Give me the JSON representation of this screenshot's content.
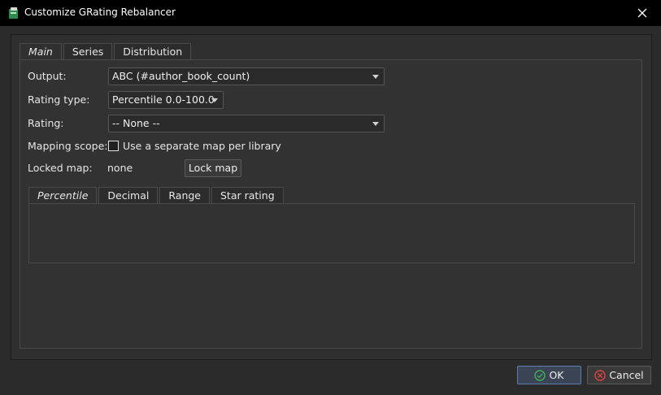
{
  "window": {
    "title": "Customize GRating Rebalancer",
    "icon": "book-icon",
    "close_icon": "close-icon"
  },
  "main_tabs": [
    {
      "label": "Main",
      "active": true
    },
    {
      "label": "Series",
      "active": false
    },
    {
      "label": "Distribution",
      "active": false
    }
  ],
  "main": {
    "output": {
      "label": "Output:",
      "value": "ABC (#author_book_count)"
    },
    "rating_type": {
      "label": "Rating type:",
      "value": "Percentile 0.0-100.0"
    },
    "rating": {
      "label": "Rating:",
      "value": "-- None --"
    },
    "mapping_scope": {
      "label": "Mapping scope:",
      "checkbox_label": "Use a separate map per library",
      "checked": false
    },
    "locked_map": {
      "label": "Locked map:",
      "value": "none",
      "button_label": "Lock map"
    }
  },
  "rating_tabs": [
    {
      "label": "Percentile",
      "active": true
    },
    {
      "label": "Decimal",
      "active": false
    },
    {
      "label": "Range",
      "active": false
    },
    {
      "label": "Star rating",
      "active": false
    }
  ],
  "buttons": {
    "ok_label": "OK",
    "ok_icon": "check-circle-icon",
    "cancel_label": "Cancel",
    "cancel_icon": "cancel-circle-icon"
  },
  "colors": {
    "background": "#2b2b2b",
    "titlebar": "#000000",
    "ok_border": "#5b7fb5",
    "ok_icon": "#3fae5a",
    "cancel_icon": "#d9453d"
  }
}
